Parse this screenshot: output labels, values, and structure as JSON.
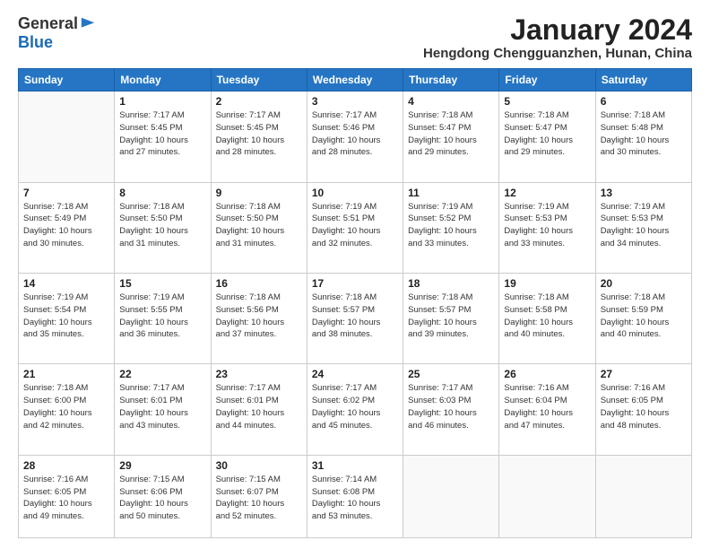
{
  "header": {
    "logo_general": "General",
    "logo_blue": "Blue",
    "month_title": "January 2024",
    "location": "Hengdong Chengguanzhen, Hunan, China"
  },
  "days_of_week": [
    "Sunday",
    "Monday",
    "Tuesday",
    "Wednesday",
    "Thursday",
    "Friday",
    "Saturday"
  ],
  "weeks": [
    [
      {
        "day": "",
        "sunrise": "",
        "sunset": "",
        "daylight": ""
      },
      {
        "day": "1",
        "sunrise": "Sunrise: 7:17 AM",
        "sunset": "Sunset: 5:45 PM",
        "daylight": "Daylight: 10 hours and 27 minutes."
      },
      {
        "day": "2",
        "sunrise": "Sunrise: 7:17 AM",
        "sunset": "Sunset: 5:45 PM",
        "daylight": "Daylight: 10 hours and 28 minutes."
      },
      {
        "day": "3",
        "sunrise": "Sunrise: 7:17 AM",
        "sunset": "Sunset: 5:46 PM",
        "daylight": "Daylight: 10 hours and 28 minutes."
      },
      {
        "day": "4",
        "sunrise": "Sunrise: 7:18 AM",
        "sunset": "Sunset: 5:47 PM",
        "daylight": "Daylight: 10 hours and 29 minutes."
      },
      {
        "day": "5",
        "sunrise": "Sunrise: 7:18 AM",
        "sunset": "Sunset: 5:47 PM",
        "daylight": "Daylight: 10 hours and 29 minutes."
      },
      {
        "day": "6",
        "sunrise": "Sunrise: 7:18 AM",
        "sunset": "Sunset: 5:48 PM",
        "daylight": "Daylight: 10 hours and 30 minutes."
      }
    ],
    [
      {
        "day": "7",
        "sunrise": "Sunrise: 7:18 AM",
        "sunset": "Sunset: 5:49 PM",
        "daylight": "Daylight: 10 hours and 30 minutes."
      },
      {
        "day": "8",
        "sunrise": "Sunrise: 7:18 AM",
        "sunset": "Sunset: 5:50 PM",
        "daylight": "Daylight: 10 hours and 31 minutes."
      },
      {
        "day": "9",
        "sunrise": "Sunrise: 7:18 AM",
        "sunset": "Sunset: 5:50 PM",
        "daylight": "Daylight: 10 hours and 31 minutes."
      },
      {
        "day": "10",
        "sunrise": "Sunrise: 7:19 AM",
        "sunset": "Sunset: 5:51 PM",
        "daylight": "Daylight: 10 hours and 32 minutes."
      },
      {
        "day": "11",
        "sunrise": "Sunrise: 7:19 AM",
        "sunset": "Sunset: 5:52 PM",
        "daylight": "Daylight: 10 hours and 33 minutes."
      },
      {
        "day": "12",
        "sunrise": "Sunrise: 7:19 AM",
        "sunset": "Sunset: 5:53 PM",
        "daylight": "Daylight: 10 hours and 33 minutes."
      },
      {
        "day": "13",
        "sunrise": "Sunrise: 7:19 AM",
        "sunset": "Sunset: 5:53 PM",
        "daylight": "Daylight: 10 hours and 34 minutes."
      }
    ],
    [
      {
        "day": "14",
        "sunrise": "Sunrise: 7:19 AM",
        "sunset": "Sunset: 5:54 PM",
        "daylight": "Daylight: 10 hours and 35 minutes."
      },
      {
        "day": "15",
        "sunrise": "Sunrise: 7:19 AM",
        "sunset": "Sunset: 5:55 PM",
        "daylight": "Daylight: 10 hours and 36 minutes."
      },
      {
        "day": "16",
        "sunrise": "Sunrise: 7:18 AM",
        "sunset": "Sunset: 5:56 PM",
        "daylight": "Daylight: 10 hours and 37 minutes."
      },
      {
        "day": "17",
        "sunrise": "Sunrise: 7:18 AM",
        "sunset": "Sunset: 5:57 PM",
        "daylight": "Daylight: 10 hours and 38 minutes."
      },
      {
        "day": "18",
        "sunrise": "Sunrise: 7:18 AM",
        "sunset": "Sunset: 5:57 PM",
        "daylight": "Daylight: 10 hours and 39 minutes."
      },
      {
        "day": "19",
        "sunrise": "Sunrise: 7:18 AM",
        "sunset": "Sunset: 5:58 PM",
        "daylight": "Daylight: 10 hours and 40 minutes."
      },
      {
        "day": "20",
        "sunrise": "Sunrise: 7:18 AM",
        "sunset": "Sunset: 5:59 PM",
        "daylight": "Daylight: 10 hours and 40 minutes."
      }
    ],
    [
      {
        "day": "21",
        "sunrise": "Sunrise: 7:18 AM",
        "sunset": "Sunset: 6:00 PM",
        "daylight": "Daylight: 10 hours and 42 minutes."
      },
      {
        "day": "22",
        "sunrise": "Sunrise: 7:17 AM",
        "sunset": "Sunset: 6:01 PM",
        "daylight": "Daylight: 10 hours and 43 minutes."
      },
      {
        "day": "23",
        "sunrise": "Sunrise: 7:17 AM",
        "sunset": "Sunset: 6:01 PM",
        "daylight": "Daylight: 10 hours and 44 minutes."
      },
      {
        "day": "24",
        "sunrise": "Sunrise: 7:17 AM",
        "sunset": "Sunset: 6:02 PM",
        "daylight": "Daylight: 10 hours and 45 minutes."
      },
      {
        "day": "25",
        "sunrise": "Sunrise: 7:17 AM",
        "sunset": "Sunset: 6:03 PM",
        "daylight": "Daylight: 10 hours and 46 minutes."
      },
      {
        "day": "26",
        "sunrise": "Sunrise: 7:16 AM",
        "sunset": "Sunset: 6:04 PM",
        "daylight": "Daylight: 10 hours and 47 minutes."
      },
      {
        "day": "27",
        "sunrise": "Sunrise: 7:16 AM",
        "sunset": "Sunset: 6:05 PM",
        "daylight": "Daylight: 10 hours and 48 minutes."
      }
    ],
    [
      {
        "day": "28",
        "sunrise": "Sunrise: 7:16 AM",
        "sunset": "Sunset: 6:05 PM",
        "daylight": "Daylight: 10 hours and 49 minutes."
      },
      {
        "day": "29",
        "sunrise": "Sunrise: 7:15 AM",
        "sunset": "Sunset: 6:06 PM",
        "daylight": "Daylight: 10 hours and 50 minutes."
      },
      {
        "day": "30",
        "sunrise": "Sunrise: 7:15 AM",
        "sunset": "Sunset: 6:07 PM",
        "daylight": "Daylight: 10 hours and 52 minutes."
      },
      {
        "day": "31",
        "sunrise": "Sunrise: 7:14 AM",
        "sunset": "Sunset: 6:08 PM",
        "daylight": "Daylight: 10 hours and 53 minutes."
      },
      {
        "day": "",
        "sunrise": "",
        "sunset": "",
        "daylight": ""
      },
      {
        "day": "",
        "sunrise": "",
        "sunset": "",
        "daylight": ""
      },
      {
        "day": "",
        "sunrise": "",
        "sunset": "",
        "daylight": ""
      }
    ]
  ]
}
